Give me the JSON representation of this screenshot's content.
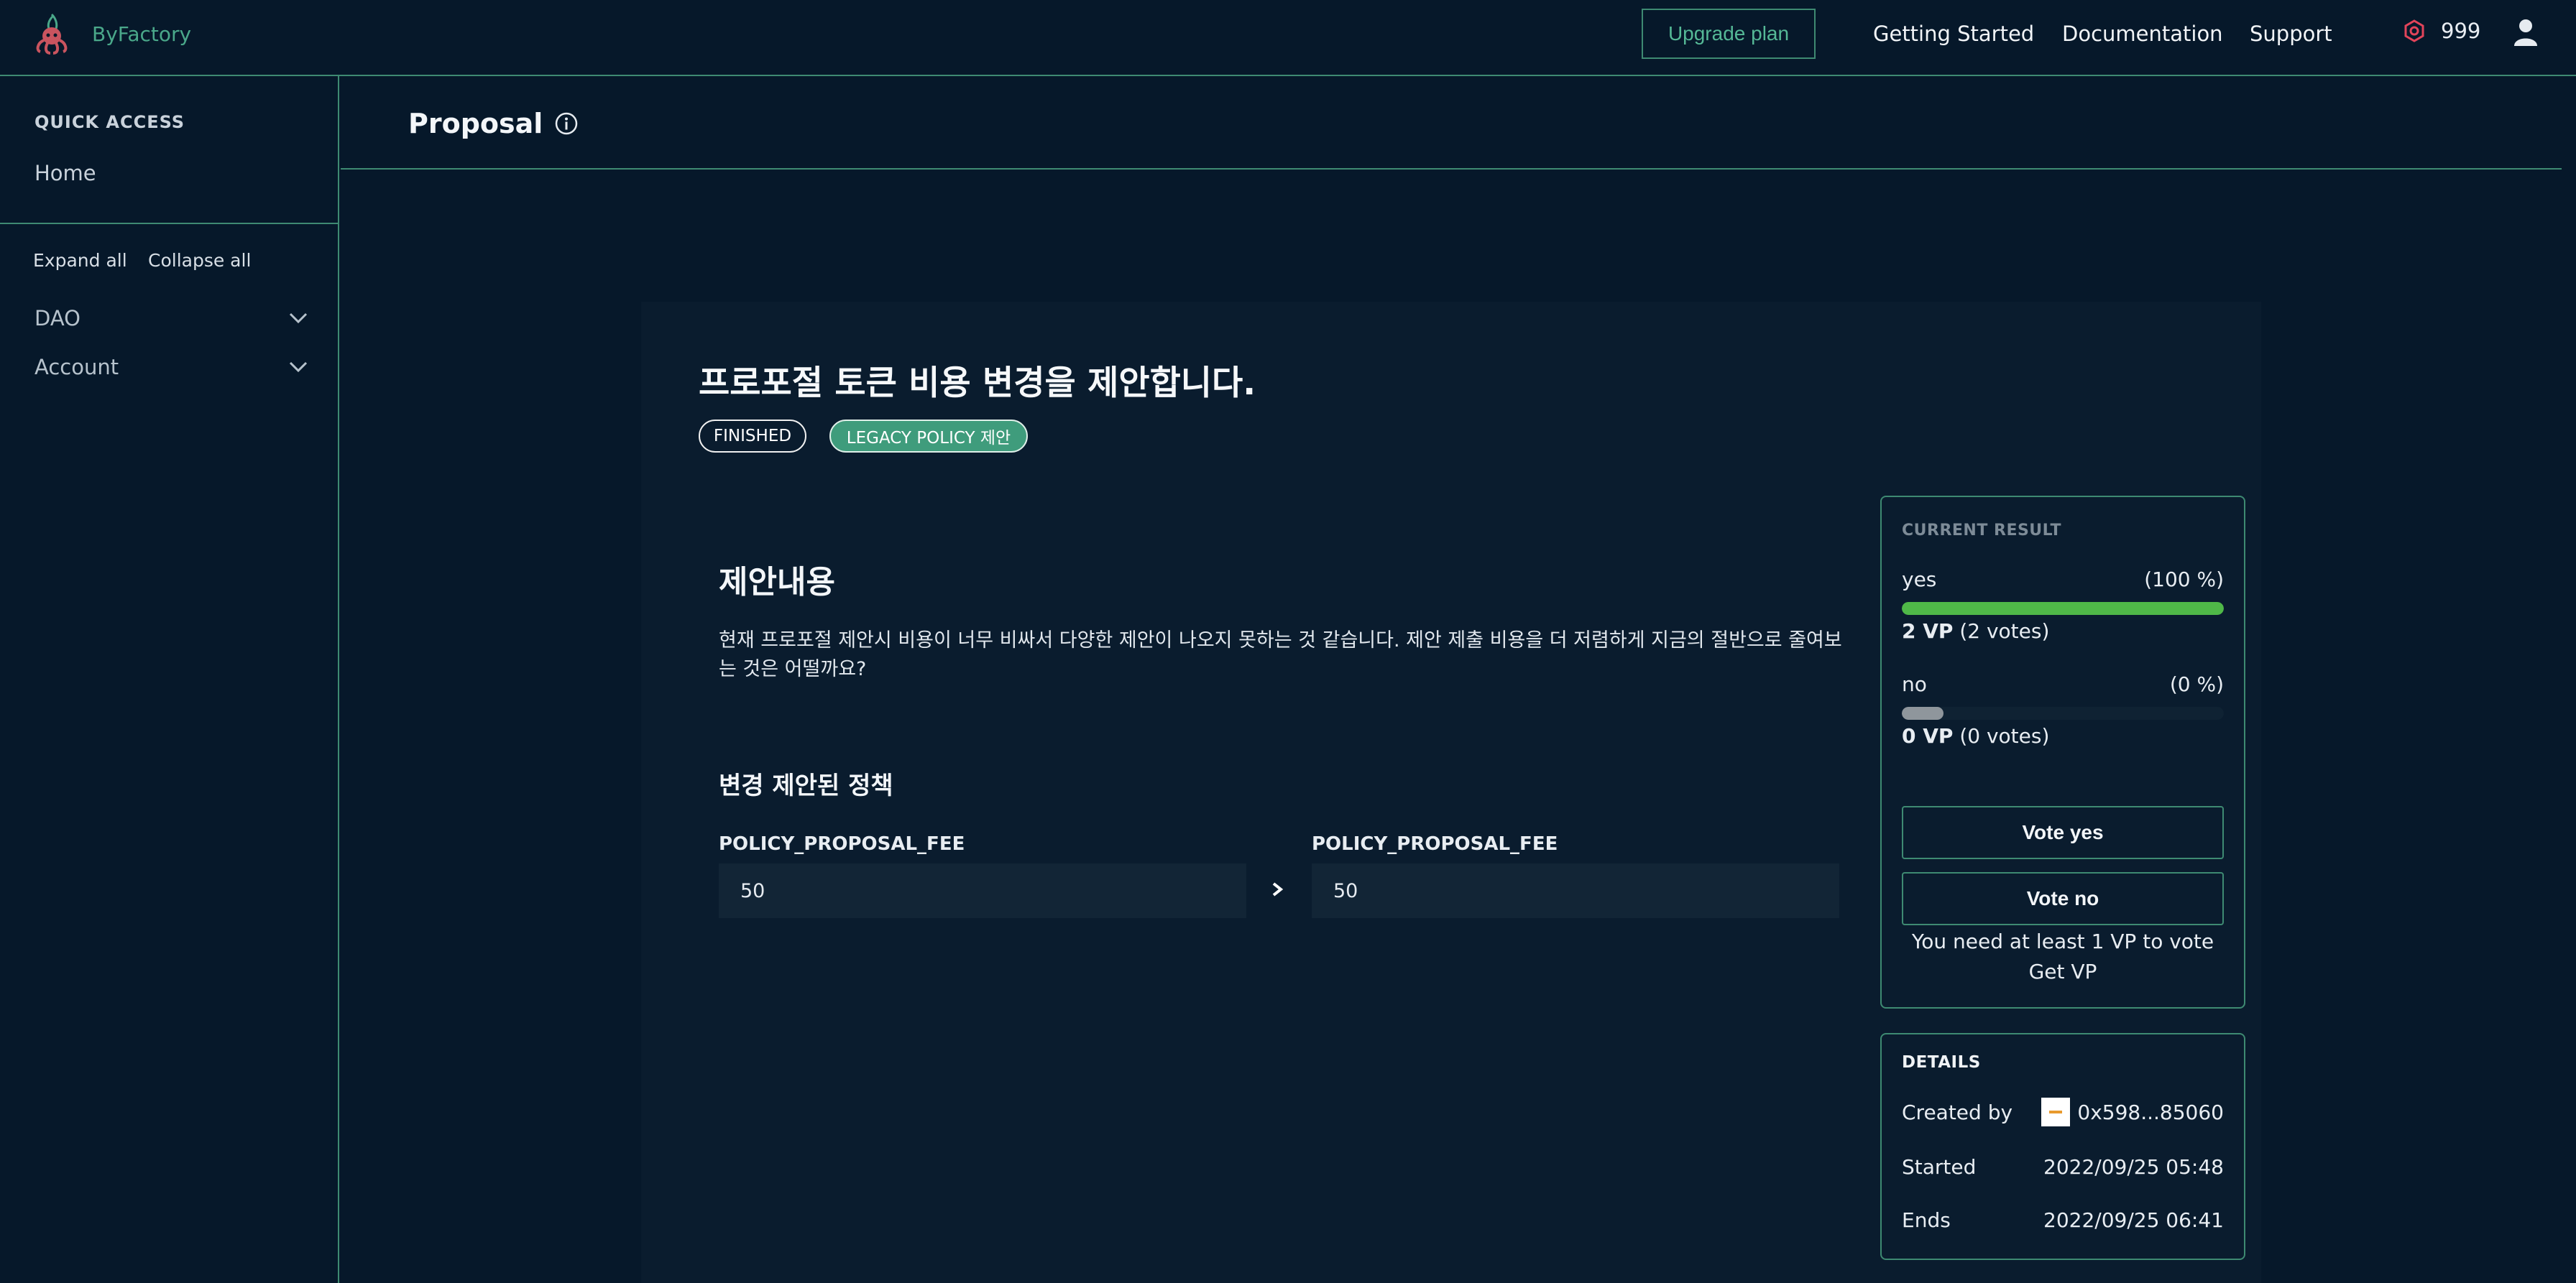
{
  "app": {
    "name": "ByFactory"
  },
  "header": {
    "upgrade_label": "Upgrade plan",
    "nav": [
      "Getting Started",
      "Documentation",
      "Support"
    ],
    "points": "999"
  },
  "sidebar": {
    "quick_access_title": "QUICK ACCESS",
    "home": "Home",
    "expand_all": "Expand all",
    "collapse_all": "Collapse all",
    "groups": [
      "DAO",
      "Account"
    ]
  },
  "page": {
    "title": "Proposal"
  },
  "proposal": {
    "title": "프로포절 토큰 비용 변경을 제안합니다.",
    "status_badge": "FINISHED",
    "type_badge": "LEGACY POLICY 제안",
    "section_title": "제안내용",
    "body": "현재 프로포절 제안시 비용이 너무 비싸서 다양한 제안이 나오지 못하는 것 같습니다. 제안 제출 비용을 더 저렴하게 지금의 절반으로 줄여보는 것은 어떨까요?",
    "policy_section_title": "변경 제안된 정책",
    "from": {
      "label": "POLICY_PROPOSAL_FEE",
      "value": "50"
    },
    "to": {
      "label": "POLICY_PROPOSAL_FEE",
      "value": "50"
    }
  },
  "result": {
    "title": "CURRENT RESULT",
    "options": [
      {
        "name": "yes",
        "percent_label": "(100 %)",
        "vp": "2 VP",
        "votes": "(2 votes)",
        "fraction": 1.0,
        "color": "#4fb848"
      },
      {
        "name": "no",
        "percent_label": "(0 %)",
        "vp": "0 VP",
        "votes": "(0 votes)",
        "fraction": 0.0,
        "color": "#8f969c"
      }
    ],
    "vote_yes": "Vote yes",
    "vote_no": "Vote no",
    "need_vp": "You need at least 1 VP to vote",
    "get_vp": "Get VP"
  },
  "details": {
    "title": "DETAILS",
    "created_by_label": "Created by",
    "created_by": "0x598...85060",
    "started_label": "Started",
    "started": "2022/09/25 05:48",
    "ends_label": "Ends",
    "ends": "2022/09/25 06:41"
  },
  "colors": {
    "accent": "#3e8a72",
    "brand_text": "#4aa88a",
    "background": "#06182a",
    "card": "#0a1c2e"
  }
}
